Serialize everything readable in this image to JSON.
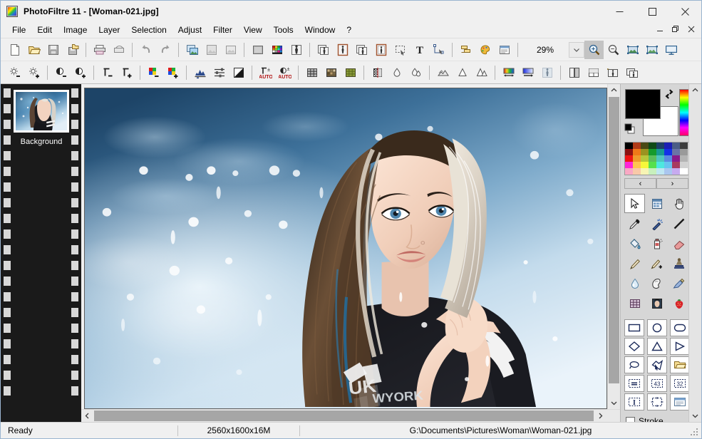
{
  "window": {
    "app_name": "PhotoFiltre 11",
    "document_name": "Woman-021.jpg",
    "title": "PhotoFiltre 11 - [Woman-021.jpg]",
    "minimize_label": "Minimize",
    "maximize_label": "Maximize",
    "close_label": "Close",
    "mdi_minimize_label": "Minimize document",
    "mdi_restore_label": "Restore document",
    "mdi_close_label": "Close document"
  },
  "menubar": {
    "items": [
      {
        "label": "File"
      },
      {
        "label": "Edit"
      },
      {
        "label": "Image"
      },
      {
        "label": "Layer"
      },
      {
        "label": "Selection"
      },
      {
        "label": "Adjust"
      },
      {
        "label": "Filter"
      },
      {
        "label": "View"
      },
      {
        "label": "Tools"
      },
      {
        "label": "Window"
      },
      {
        "label": "?"
      }
    ]
  },
  "toolbar_main": {
    "zoom_value": "29%",
    "items": [
      {
        "icon": "new-document-icon",
        "label": "New"
      },
      {
        "icon": "open-folder-icon",
        "label": "Open"
      },
      {
        "icon": "save-icon",
        "label": "Save"
      },
      {
        "icon": "save-as-icon",
        "label": "Save As"
      },
      {
        "type": "separator"
      },
      {
        "icon": "print-icon",
        "label": "Print"
      },
      {
        "icon": "page-setup-icon",
        "label": "Page setup"
      },
      {
        "type": "separator"
      },
      {
        "icon": "undo-icon",
        "label": "Undo"
      },
      {
        "icon": "redo-icon",
        "label": "Redo"
      },
      {
        "type": "separator"
      },
      {
        "icon": "copy-image-icon",
        "label": "Copy"
      },
      {
        "icon": "paste-image-icon",
        "label": "Paste"
      },
      {
        "icon": "paste-as-image-icon",
        "label": "Paste as new image"
      },
      {
        "type": "separator"
      },
      {
        "icon": "gradient-square-icon",
        "label": "Gradient"
      },
      {
        "icon": "color-palette-icon",
        "label": "Palette"
      },
      {
        "icon": "transparency-icon",
        "label": "Transparent color"
      },
      {
        "type": "separator"
      },
      {
        "icon": "batch-icon",
        "label": "Automate"
      },
      {
        "icon": "frame-image-icon",
        "label": "Frame"
      },
      {
        "icon": "export-image-icon",
        "label": "Export"
      },
      {
        "icon": "image-frame-icon",
        "label": "Image frame"
      },
      {
        "icon": "selection-icon",
        "label": "Selection"
      },
      {
        "icon": "text-tool-icon",
        "label": "Text"
      },
      {
        "icon": "vector-select-icon",
        "label": "Vector selection"
      },
      {
        "type": "separator"
      },
      {
        "icon": "layers-icon",
        "label": "Layers manager"
      },
      {
        "icon": "effects-icon",
        "label": "Effects"
      },
      {
        "icon": "window-list-icon",
        "label": "Explorer"
      },
      {
        "type": "separator"
      },
      {
        "type": "zoom"
      },
      {
        "icon": "zoom-in-icon",
        "label": "Zoom in"
      },
      {
        "icon": "zoom-out-icon",
        "label": "Zoom out"
      },
      {
        "icon": "fit-image-icon",
        "label": "Fit to screen"
      },
      {
        "icon": "actual-size-icon",
        "label": "Actual size"
      },
      {
        "icon": "fullscreen-icon",
        "label": "Full screen"
      }
    ]
  },
  "toolbar_adjust": {
    "items": [
      {
        "icon": "brightness-down-icon",
        "label": "Brightness -"
      },
      {
        "icon": "brightness-up-icon",
        "label": "Brightness +"
      },
      {
        "type": "separator"
      },
      {
        "icon": "contrast-down-icon",
        "label": "Contrast -"
      },
      {
        "icon": "contrast-up-icon",
        "label": "Contrast +"
      },
      {
        "type": "separator"
      },
      {
        "icon": "gamma-down-icon",
        "label": "Gamma -"
      },
      {
        "icon": "gamma-up-icon",
        "label": "Gamma +"
      },
      {
        "type": "separator"
      },
      {
        "icon": "saturation-down-icon",
        "label": "Saturation -"
      },
      {
        "icon": "saturation-up-icon",
        "label": "Saturation +"
      },
      {
        "type": "separator"
      },
      {
        "icon": "histogram-icon",
        "label": "Histogram"
      },
      {
        "icon": "levels-icon",
        "label": "Levels"
      },
      {
        "icon": "contrast-mask-icon",
        "label": "Contrast mask"
      },
      {
        "type": "separator"
      },
      {
        "icon": "auto-gamma-icon",
        "label": "Auto gamma"
      },
      {
        "icon": "auto-contrast-icon",
        "label": "Auto contrast"
      },
      {
        "type": "separator"
      },
      {
        "icon": "grid-icon",
        "label": "Grid"
      },
      {
        "icon": "mosaic-icon",
        "label": "Mosaic"
      },
      {
        "icon": "pattern-icon",
        "label": "Pattern"
      },
      {
        "type": "separator"
      },
      {
        "icon": "halftone-icon",
        "label": "Halftone"
      },
      {
        "icon": "blur-drop-icon",
        "label": "Blur"
      },
      {
        "icon": "blur-more-icon",
        "label": "Blur more"
      },
      {
        "type": "separator"
      },
      {
        "icon": "soften-icon",
        "label": "Soften"
      },
      {
        "icon": "sharpen-icon",
        "label": "Sharpen"
      },
      {
        "icon": "sharpen-more-icon",
        "label": "Sharpen more"
      },
      {
        "type": "separator"
      },
      {
        "icon": "spectrum-gradient-icon",
        "label": "Color gradient"
      },
      {
        "icon": "linear-gradient-icon",
        "label": "Linear gradient"
      },
      {
        "icon": "texture-icon",
        "label": "Texture"
      },
      {
        "type": "separator"
      },
      {
        "icon": "split-view-icon",
        "label": "Split view"
      },
      {
        "icon": "page-layout-icon",
        "label": "Page layout"
      },
      {
        "icon": "image-effect-icon",
        "label": "Image effect"
      },
      {
        "icon": "batch-effect-icon",
        "label": "Batch effect"
      }
    ]
  },
  "layers_panel": {
    "layers": [
      {
        "name": "Background",
        "selected": true
      }
    ]
  },
  "color_panel": {
    "foreground_color": "#000000",
    "background_color": "#ffffff",
    "swap_icon": "swap-colors-icon",
    "reset_icon": "reset-colors-icon",
    "hue_strip_icon": "hue-spectrum-strip",
    "prev_label": "‹",
    "next_label": "›",
    "palette": [
      "#000000",
      "#b03a18",
      "#4a4a14",
      "#0f4a16",
      "#1c3f66",
      "#1b1fb4",
      "#4a5d86",
      "#3c3c3c",
      "#8c1111",
      "#f07818",
      "#9a9320",
      "#159b2c",
      "#179a93",
      "#1430e8",
      "#6a74a6",
      "#9a9a9a",
      "#ef1414",
      "#f09a2c",
      "#b7c73a",
      "#5bbf5c",
      "#4dc6c0",
      "#5a8ae0",
      "#8a1b8a",
      "#b4b4b4",
      "#ff26d6",
      "#ffc44f",
      "#f7f73a",
      "#56e04e",
      "#4de8e0",
      "#67c4ef",
      "#a83a60",
      "#d2d2d2",
      "#f9a8c4",
      "#f9c9a8",
      "#f7f4b4",
      "#c8f0bd",
      "#bfe6f2",
      "#aac6ef",
      "#c7aaef",
      "#ffffff"
    ]
  },
  "tools_panel": {
    "tools": [
      {
        "icon": "arrow-select-icon",
        "label": "Selection / move",
        "selected": true
      },
      {
        "icon": "clipboard-icon",
        "label": "Paste / clone source"
      },
      {
        "icon": "hand-icon",
        "label": "Hand / pan"
      },
      {
        "icon": "eyedropper-icon",
        "label": "Color picker"
      },
      {
        "icon": "magic-wand-icon",
        "label": "Magic wand"
      },
      {
        "icon": "line-icon",
        "label": "Line"
      },
      {
        "icon": "paint-bucket-icon",
        "label": "Paint bucket"
      },
      {
        "icon": "spray-can-icon",
        "label": "Airbrush"
      },
      {
        "icon": "eraser-icon",
        "label": "Eraser"
      },
      {
        "icon": "paintbrush-icon",
        "label": "Paintbrush"
      },
      {
        "icon": "paintbrush-plus-icon",
        "label": "Advanced brush"
      },
      {
        "icon": "stamp-icon",
        "label": "Clone stamp"
      },
      {
        "icon": "water-drop-icon",
        "label": "Blur / sharpen"
      },
      {
        "icon": "smudge-finger-icon",
        "label": "Smudge"
      },
      {
        "icon": "brush-stroke-icon",
        "label": "Artistic brush"
      },
      {
        "icon": "mesh-grid-icon",
        "label": "Deform mesh"
      },
      {
        "icon": "photo-thumb-icon",
        "label": "Image brush"
      },
      {
        "icon": "strawberry-icon",
        "label": "Stamp gallery"
      }
    ]
  },
  "shapes_panel": {
    "shapes": [
      {
        "icon": "rectangle-icon",
        "label": "Rectangle"
      },
      {
        "icon": "ellipse-icon",
        "label": "Ellipse"
      },
      {
        "icon": "rounded-rectangle-icon",
        "label": "Rounded rectangle"
      },
      {
        "icon": "diamond-icon",
        "label": "Diamond"
      },
      {
        "icon": "triangle-icon",
        "label": "Triangle"
      },
      {
        "icon": "right-triangle-icon",
        "label": "Right triangle"
      },
      {
        "icon": "lasso-icon",
        "label": "Lasso"
      },
      {
        "icon": "polygon-icon",
        "label": "Polygon"
      },
      {
        "icon": "open-shape-folder-icon",
        "label": "Load shape"
      },
      {
        "icon": "selection-resize-icon",
        "label": "Resize selection"
      },
      {
        "icon": "selection-43-icon",
        "label": "Ratio 4:3"
      },
      {
        "icon": "selection-32-icon",
        "label": "Ratio 3:2"
      },
      {
        "icon": "selection-vertical-icon",
        "label": "Vertical ratio"
      },
      {
        "icon": "selection-free-icon",
        "label": "Free transform"
      },
      {
        "icon": "selection-options-icon",
        "label": "Selection options"
      }
    ],
    "stroke_label": "Stroke",
    "stroke_checked": false
  },
  "scrollbars": {
    "vertical_up": "⌃",
    "vertical_down": "⌄",
    "horizontal_left": "‹",
    "horizontal_right": "›",
    "dock_up": "⌃",
    "dock_down": "⌄"
  },
  "statusbar": {
    "state": "Ready",
    "image_info": "2560x1600x16M",
    "file_path": "G:\\Documents\\Pictures\\Woman\\Woman-021.jpg"
  },
  "image_content": {
    "description": "Winter portrait of a young woman with long blond and brown hair against a snowy blue bokeh background",
    "jersey_text_1": "WYORK",
    "jersey_text_2": "UK"
  }
}
